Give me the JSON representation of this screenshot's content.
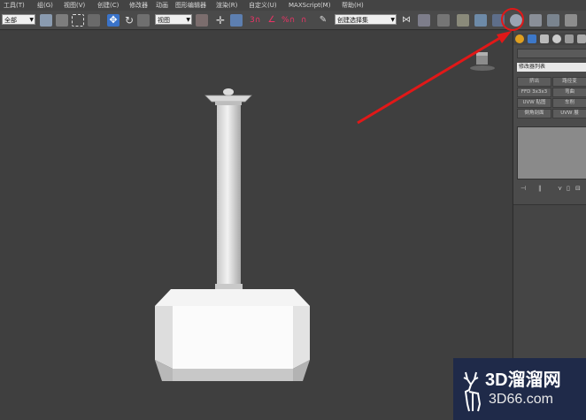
{
  "menubar": {
    "items": [
      "工具(T)",
      "组(G)",
      "视图(V)",
      "创建(C)",
      "修改器",
      "动画",
      "图形编辑器",
      "渲染(R)",
      "自定义(U)",
      "MAXScript(M)",
      "帮助(H)"
    ]
  },
  "toolbar": {
    "selection_filter": "全部",
    "coord_system": "视图",
    "named_selection": "创建选择集",
    "labels": {
      "snap_3": "3",
      "percent": "%"
    }
  },
  "panel": {
    "modifier_list": "修改器列表",
    "buttons": [
      "挤出",
      "路径变",
      "FFD 3x3x3",
      "弯曲",
      "UVW 贴图",
      "车削",
      "倒角剖面",
      "UVW 展"
    ]
  },
  "watermark": {
    "brand": "3D溜溜网",
    "url": "3D66.com"
  },
  "colors": {
    "annotation_red": "#e11818",
    "active_blue": "#3a73c9",
    "watermark_bg": "#1f2a49"
  }
}
